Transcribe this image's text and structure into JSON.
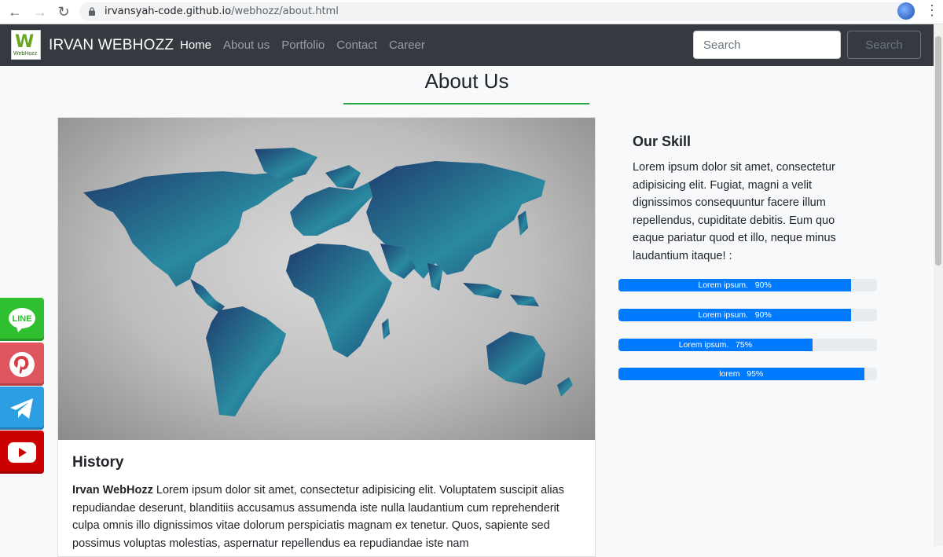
{
  "browser": {
    "url_domain": "irvansyah-code.github.io",
    "url_path": "/webhozz/about.html"
  },
  "navbar": {
    "logo_text": "WebHozz",
    "brand": "IRVAN WEBHOZZ",
    "links": [
      "Home",
      "About us",
      "Portfolio",
      "Contact",
      "Career"
    ],
    "active": "Home",
    "search_placeholder": "Search",
    "search_button": "Search"
  },
  "page": {
    "title": "About Us",
    "accent_color": "#28a745"
  },
  "history": {
    "title": "History",
    "lead": "Irvan WebHozz",
    "text": " Lorem ipsum dolor sit amet, consectetur adipisicing elit. Voluptatem suscipit alias repudiandae deserunt, blanditiis accusamus assumenda iste nulla laudantium cum reprehenderit culpa omnis illo dignissimos vitae dolorum perspiciatis magnam ex tenetur. Quos, sapiente sed possimus voluptas molestias, aspernatur repellendus ea repudiandae iste nam"
  },
  "skills": {
    "title": "Our Skill",
    "text": "Lorem ipsum dolor sit amet, consectetur adipisicing elit. Fugiat, magni a velit dignissimos consequuntur facere illum repellendus, cupiditate debitis. Eum quo eaque pariatur quod et illo, neque minus laudantium itaque! :",
    "bars": [
      {
        "label": "Lorem ipsum.   90%",
        "value": 90
      },
      {
        "label": "Lorem ipsum.   90%",
        "value": 90
      },
      {
        "label": "Lorem ipsum.   75%",
        "value": 75
      },
      {
        "label": "lorem   95%",
        "value": 95
      }
    ],
    "bar_color": "#007bff"
  },
  "social": {
    "line_label": "LINE",
    "line_color": "#2fc02f",
    "pinterest_color": "#e0565f",
    "telegram_color": "#2e9ee3",
    "youtube_color": "#cc0000"
  }
}
